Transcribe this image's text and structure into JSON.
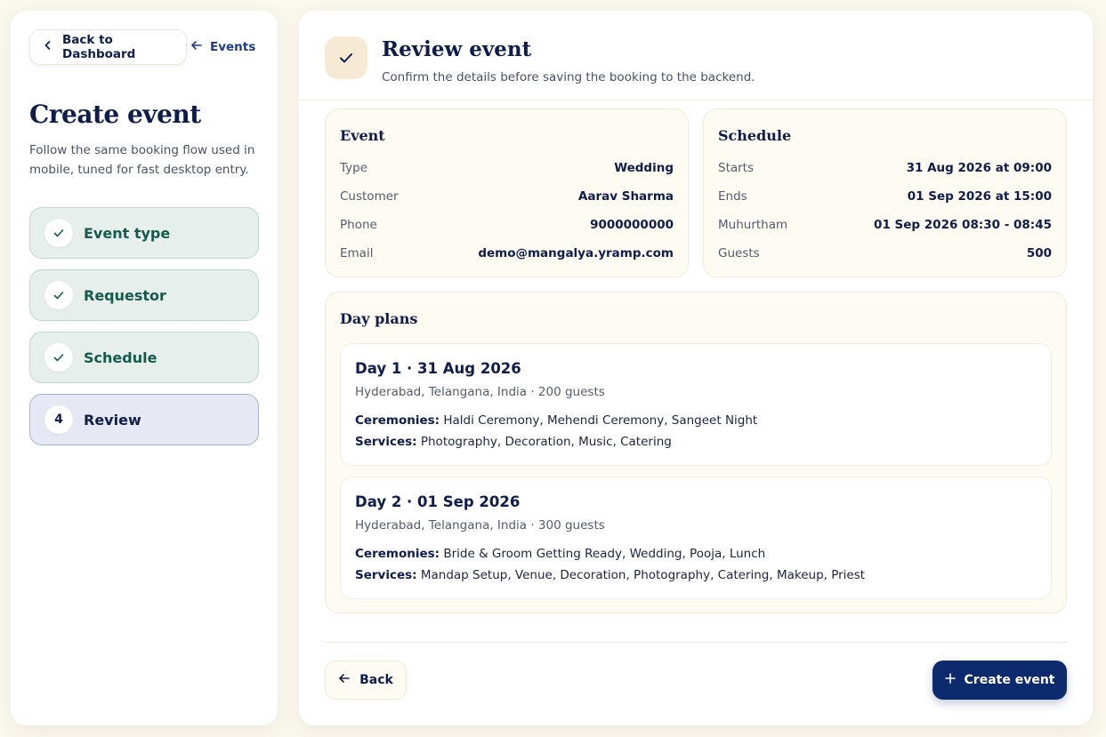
{
  "nav": {
    "back_dashboard": "Back to Dashboard",
    "events": "Events"
  },
  "sidebar": {
    "title": "Create event",
    "description": "Follow the same booking flow used in mobile, tuned for fast desktop entry.",
    "steps": [
      {
        "label": "Event type",
        "status": "done"
      },
      {
        "label": "Requestor",
        "status": "done"
      },
      {
        "label": "Schedule",
        "status": "done"
      },
      {
        "label": "Review",
        "status": "active",
        "number": "4"
      }
    ]
  },
  "header": {
    "title": "Review event",
    "subtitle": "Confirm the details before saving the booking to the backend."
  },
  "event_card": {
    "title": "Event",
    "rows": [
      {
        "key": "Type",
        "value": "Wedding"
      },
      {
        "key": "Customer",
        "value": "Aarav Sharma"
      },
      {
        "key": "Phone",
        "value": "9000000000"
      },
      {
        "key": "Email",
        "value": "demo@mangalya.yramp.com"
      }
    ]
  },
  "schedule_card": {
    "title": "Schedule",
    "rows": [
      {
        "key": "Starts",
        "value": "31 Aug 2026 at 09:00"
      },
      {
        "key": "Ends",
        "value": "01 Sep 2026 at 15:00"
      },
      {
        "key": "Muhurtham",
        "value": "01 Sep 2026 08:30 - 08:45"
      },
      {
        "key": "Guests",
        "value": "500"
      }
    ]
  },
  "day_plans": {
    "title": "Day plans",
    "ceremonies_label": "Ceremonies:",
    "services_label": "Services:",
    "days": [
      {
        "title": "Day 1 · 31 Aug 2026",
        "location": "Hyderabad, Telangana, India · 200 guests",
        "ceremonies": "Haldi Ceremony, Mehendi Ceremony, Sangeet Night",
        "services": "Photography, Decoration, Music, Catering"
      },
      {
        "title": "Day 2 · 01 Sep 2026",
        "location": "Hyderabad, Telangana, India · 300 guests",
        "ceremonies": "Bride & Groom Getting Ready, Wedding, Pooja, Lunch",
        "services": "Mandap Setup, Venue, Decoration, Photography, Catering, Makeup, Priest"
      }
    ]
  },
  "footer": {
    "back_label": "Back",
    "create_label": "Create event"
  },
  "colors": {
    "primary": "#0d2a6e",
    "success": "#155a4d",
    "background": "#fbf8ee"
  }
}
